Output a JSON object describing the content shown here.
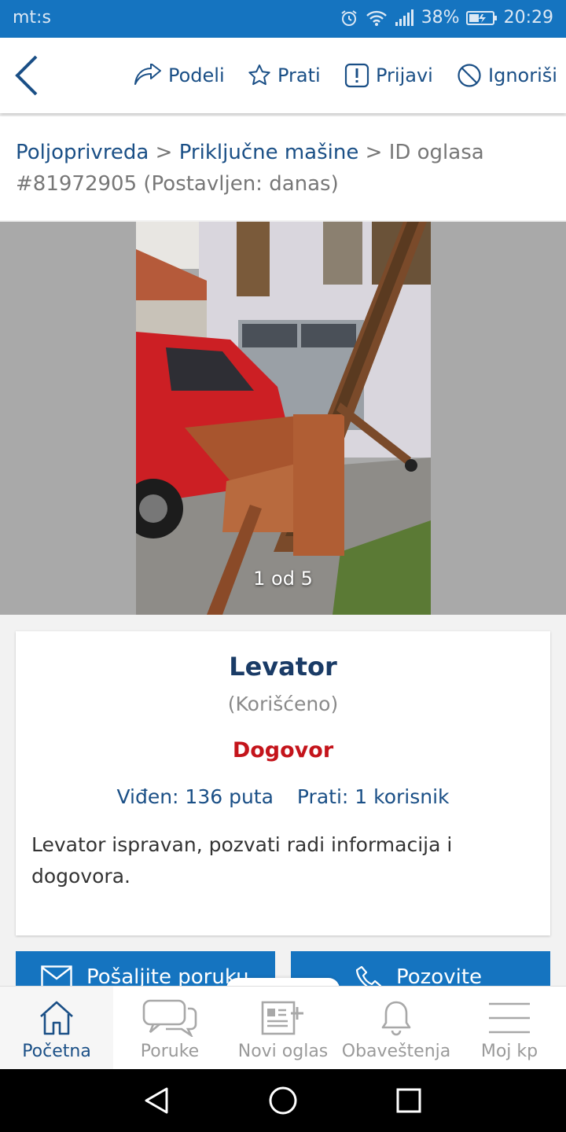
{
  "status_bar": {
    "carrier": "mt:s",
    "battery": "38%",
    "time": "20:29"
  },
  "actions": {
    "share_label": "Podeli",
    "follow_label": "Prati",
    "report_label": "Prijavi",
    "ignore_label": "Ignoriši"
  },
  "breadcrumb": {
    "category": "Poljoprivreda",
    "separator": ">",
    "subcategory": "Priključne mašine",
    "id_text": "ID oglasa #81972905 (Postavljen: danas)"
  },
  "gallery": {
    "counter": "1 od 5"
  },
  "listing": {
    "title": "Levator",
    "condition": "(Korišćeno)",
    "price": "Dogovor",
    "views": "Viđen: 136 puta",
    "followers": "Prati: 1 korisnik",
    "description": "Levator ispravan, pozvati radi informacija i dogovora."
  },
  "cta": {
    "message_label": "Pošaljite poruku",
    "call_label": "Pozovite"
  },
  "bottom_nav": {
    "home": "Početna",
    "messages": "Poruke",
    "new_ad": "Novi oglas",
    "notifications": "Obaveštenja",
    "my_kp": "Moj kp"
  },
  "colors": {
    "brand_blue": "#1574c0",
    "link_blue": "#1a4f86",
    "price_red": "#c4141b"
  }
}
